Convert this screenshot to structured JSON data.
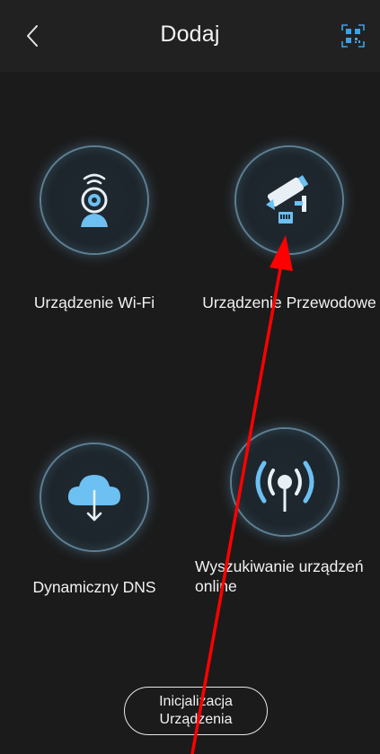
{
  "header": {
    "title": "Dodaj",
    "back_icon": "chevron-left-icon",
    "qr_icon": "qr-code-scan-icon",
    "accent_color": "#3ea1e6"
  },
  "options": [
    {
      "label": "Urządzenie Wi-Fi",
      "icon": "wifi-camera-icon"
    },
    {
      "label": "Urządzenie Przewodowe",
      "icon": "wired-camera-icon"
    },
    {
      "label": "Dynamiczny DNS",
      "icon": "cloud-download-icon"
    },
    {
      "label": "Wyszukiwanie urządzeń online",
      "icon": "radio-signal-icon"
    }
  ],
  "init_button": {
    "label_line1": "Inicjalizacja",
    "label_line2": "Urządzenia"
  },
  "annotation": {
    "icon": "red-arrow-pointer",
    "color": "#ff0000"
  }
}
